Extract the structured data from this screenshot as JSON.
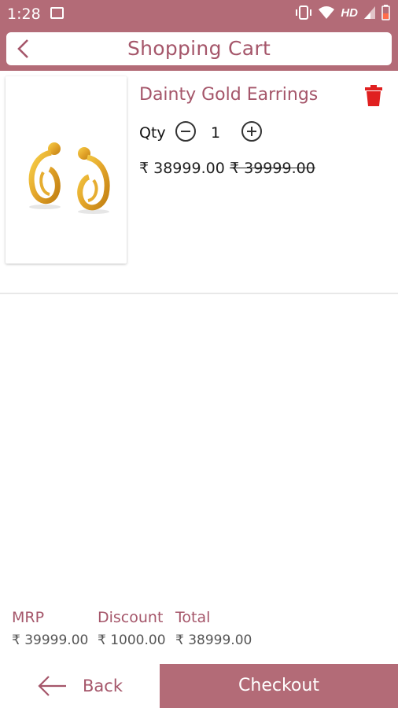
{
  "status_bar": {
    "time": "1:28",
    "network_label": "HD"
  },
  "header": {
    "title": "Shopping Cart"
  },
  "cart": {
    "items": [
      {
        "name": "Dainty Gold Earrings",
        "qty_label": "Qty",
        "qty": "1",
        "price": "₹ 38999.00",
        "original_price": "₹ 39999.00"
      }
    ]
  },
  "summary": {
    "mrp_label": "MRP",
    "mrp_value": "₹ 39999.00",
    "discount_label": "Discount",
    "discount_value": "₹ 1000.00",
    "total_label": "Total",
    "total_value": "₹ 38999.00"
  },
  "footer": {
    "back_label": "Back",
    "checkout_label": "Checkout"
  },
  "colors": {
    "brand": "#b36b77",
    "accent_text": "#a5566a",
    "delete": "#e02020"
  }
}
